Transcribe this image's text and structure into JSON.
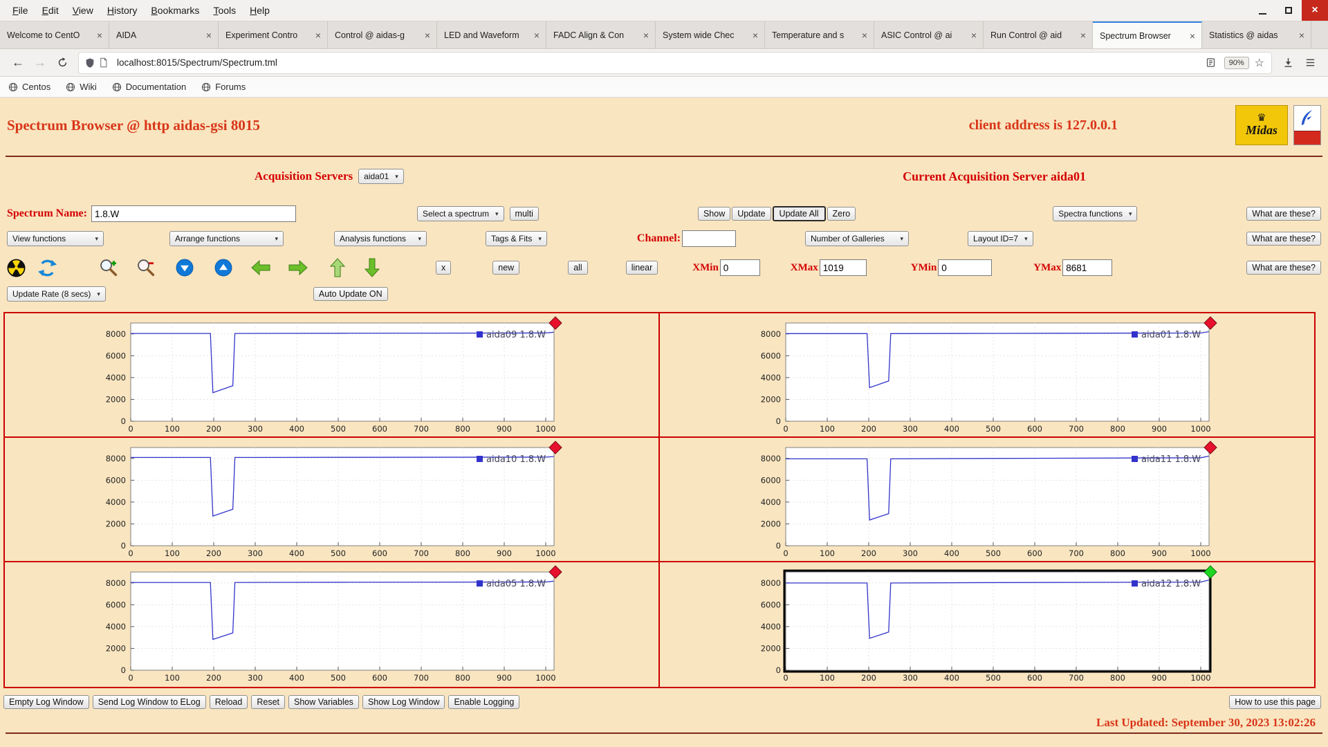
{
  "colors": {
    "accent_red": "#d40000",
    "page_bg": "#f9e5c0",
    "plot_line": "#3333cc",
    "marker_red": "#e8112d",
    "marker_green": "#1fd61f",
    "grid_red": "#cc0000"
  },
  "icons": {
    "caret": "▾",
    "close": "×",
    "back": "←",
    "forward": "→",
    "star": "☆",
    "crown": "♛"
  },
  "browser": {
    "menus": [
      "File",
      "Edit",
      "View",
      "History",
      "Bookmarks",
      "Tools",
      "Help"
    ],
    "tabs": [
      {
        "label": "Welcome to CentO",
        "active": false
      },
      {
        "label": "AIDA",
        "active": false
      },
      {
        "label": "Experiment Contro",
        "active": false
      },
      {
        "label": "Control @ aidas-g",
        "active": false
      },
      {
        "label": "LED and Waveform",
        "active": false
      },
      {
        "label": "FADC Align & Con",
        "active": false
      },
      {
        "label": "System wide Chec",
        "active": false
      },
      {
        "label": "Temperature and s",
        "active": false
      },
      {
        "label": "ASIC Control @ ai",
        "active": false
      },
      {
        "label": "Run Control @ aid",
        "active": false
      },
      {
        "label": "Spectrum Browser",
        "active": true
      },
      {
        "label": "Statistics @ aidas",
        "active": false
      }
    ],
    "url": "localhost:8015/Spectrum/Spectrum.tml",
    "zoom_badge": "90%",
    "bookmarks": [
      "Centos",
      "Wiki",
      "Documentation",
      "Forums"
    ]
  },
  "header": {
    "title": "Spectrum Browser @ http aidas-gsi 8015",
    "client_address": "client address is 127.0.0.1",
    "midas_logo_text": "Midas"
  },
  "server_row": {
    "label": "Acquisition Servers",
    "selected": "aida01",
    "current": "Current Acquisition Server aida01"
  },
  "common": {
    "what_are_these": "What are these?"
  },
  "spectrum_row": {
    "name_label": "Spectrum Name:",
    "name_value": "1.8.W",
    "select_spectrum": "Select a spectrum",
    "multi": "multi",
    "show": "Show",
    "update": "Update",
    "update_all": "Update All",
    "zero": "Zero",
    "spectra_functions": "Spectra functions"
  },
  "functions_row": {
    "view_functions": "View functions",
    "arrange_functions": "Arrange functions",
    "analysis_functions": "Analysis functions",
    "tags_fits": "Tags & Fits",
    "channel_label": "Channel:",
    "channel_value": "",
    "galleries": "Number of Galleries",
    "layout": "Layout ID=7"
  },
  "tools_row": {
    "x": "x",
    "new": "new",
    "all": "all",
    "linear": "linear",
    "xmin_label": "XMin",
    "xmin": "0",
    "xmax_label": "XMax",
    "xmax": "1019",
    "ymin_label": "YMin",
    "ymin": "0",
    "ymax_label": "YMax",
    "ymax": "8681"
  },
  "update_row": {
    "update_rate": "Update Rate (8 secs)",
    "auto_update": "Auto Update ON"
  },
  "footer": {
    "buttons": [
      "Empty Log Window",
      "Send Log Window to ELog",
      "Reload",
      "Reset",
      "Show Variables",
      "Show Log Window",
      "Enable Logging"
    ],
    "help": "How to use this page",
    "last_updated": "Last Updated: September 30, 2023 13:02:26"
  },
  "chart_data": [
    {
      "type": "line",
      "legend": "aida09 1.8.W",
      "marker": "red",
      "highlighted": false,
      "line_color": "#3333cc",
      "title": "",
      "xlabel": "",
      "ylabel": "",
      "x": [
        0,
        192,
        198,
        246,
        251,
        500,
        1000,
        1019
      ],
      "y": [
        8040,
        8040,
        2620,
        3260,
        8040,
        8060,
        8090,
        8160
      ],
      "xlim": [
        0,
        1020
      ],
      "ylim": [
        0,
        9000
      ],
      "xticks": [
        0,
        100,
        200,
        300,
        400,
        500,
        600,
        700,
        800,
        900,
        1000
      ],
      "yticks": [
        0,
        2000,
        4000,
        6000,
        8000
      ]
    },
    {
      "type": "line",
      "legend": "aida01 1.8.W",
      "marker": "red",
      "highlighted": false,
      "line_color": "#3333cc",
      "title": "",
      "xlabel": "",
      "ylabel": "",
      "x": [
        0,
        196,
        202,
        248,
        253,
        500,
        1000,
        1019
      ],
      "y": [
        8030,
        8030,
        3080,
        3680,
        8030,
        8050,
        8090,
        8200
      ],
      "xlim": [
        0,
        1020
      ],
      "ylim": [
        0,
        9000
      ],
      "xticks": [
        0,
        100,
        200,
        300,
        400,
        500,
        600,
        700,
        800,
        900,
        1000
      ],
      "yticks": [
        0,
        2000,
        4000,
        6000,
        8000
      ]
    },
    {
      "type": "line",
      "legend": "aida10 1.8.W",
      "marker": "red",
      "highlighted": false,
      "line_color": "#3333cc",
      "title": "",
      "xlabel": "",
      "ylabel": "",
      "x": [
        0,
        192,
        198,
        246,
        251,
        500,
        1000,
        1019
      ],
      "y": [
        8090,
        8090,
        2720,
        3340,
        8090,
        8100,
        8120,
        8170
      ],
      "xlim": [
        0,
        1020
      ],
      "ylim": [
        0,
        9000
      ],
      "xticks": [
        0,
        100,
        200,
        300,
        400,
        500,
        600,
        700,
        800,
        900,
        1000
      ],
      "yticks": [
        0,
        2000,
        4000,
        6000,
        8000
      ]
    },
    {
      "type": "line",
      "legend": "aida11 1.8.W",
      "marker": "red",
      "highlighted": false,
      "line_color": "#3333cc",
      "title": "",
      "xlabel": "",
      "ylabel": "",
      "x": [
        0,
        196,
        202,
        248,
        253,
        500,
        1000,
        1019
      ],
      "y": [
        7960,
        7960,
        2360,
        2940,
        7960,
        8000,
        8060,
        8210
      ],
      "xlim": [
        0,
        1020
      ],
      "ylim": [
        0,
        9000
      ],
      "xticks": [
        0,
        100,
        200,
        300,
        400,
        500,
        600,
        700,
        800,
        900,
        1000
      ],
      "yticks": [
        0,
        2000,
        4000,
        6000,
        8000
      ]
    },
    {
      "type": "line",
      "legend": "aida05 1.8.W",
      "marker": "red",
      "highlighted": false,
      "line_color": "#3333cc",
      "title": "",
      "xlabel": "",
      "ylabel": "",
      "x": [
        0,
        192,
        198,
        246,
        251,
        500,
        1000,
        1019
      ],
      "y": [
        8040,
        8040,
        2820,
        3420,
        8040,
        8060,
        8090,
        8160
      ],
      "xlim": [
        0,
        1020
      ],
      "ylim": [
        0,
        9000
      ],
      "xticks": [
        0,
        100,
        200,
        300,
        400,
        500,
        600,
        700,
        800,
        900,
        1000
      ],
      "yticks": [
        0,
        2000,
        4000,
        6000,
        8000
      ]
    },
    {
      "type": "line",
      "legend": "aida12 1.8.W",
      "marker": "green",
      "highlighted": true,
      "line_color": "#3333cc",
      "title": "",
      "xlabel": "",
      "ylabel": "",
      "x": [
        0,
        196,
        202,
        248,
        253,
        500,
        1000,
        1019
      ],
      "y": [
        7990,
        7990,
        2920,
        3500,
        7990,
        8030,
        8080,
        8260
      ],
      "xlim": [
        0,
        1020
      ],
      "ylim": [
        0,
        9000
      ],
      "xticks": [
        0,
        100,
        200,
        300,
        400,
        500,
        600,
        700,
        800,
        900,
        1000
      ],
      "yticks": [
        0,
        2000,
        4000,
        6000,
        8000
      ]
    }
  ]
}
